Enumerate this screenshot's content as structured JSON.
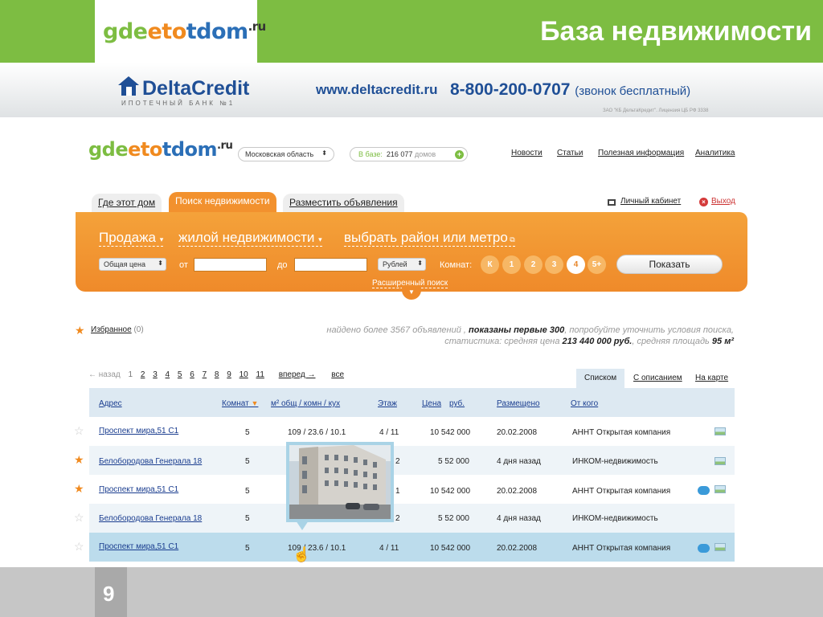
{
  "slide": {
    "logo": {
      "part1": "gde",
      "part2": "eto",
      "part3": "tdom",
      "suffix": ".ru"
    },
    "title": "База недвижимости",
    "page_number": "9"
  },
  "banner": {
    "brand": "DeltaCredit",
    "tagline": "ИПОТЕЧНЫЙ БАНК №1",
    "url": "www.deltacredit.ru",
    "phone": "8-800-200-0707",
    "phone_note": "(звонок бесплатный)",
    "legal": "ЗАО \"КБ ДельтаКредит\". Лицензия ЦБ РФ 3338"
  },
  "site": {
    "logo": {
      "part1": "gde",
      "part2": "eto",
      "part3": "tdom",
      "suffix": ".ru"
    },
    "region": "Московская область",
    "base_label": "В базе:",
    "base_count": "216 077",
    "base_unit": "домов",
    "nav": [
      "Новости",
      "Статьи",
      "Полезная информация",
      "Аналитика"
    ]
  },
  "tabs": [
    "Где этот дом",
    "Поиск недвижимости",
    "Разместить объявления"
  ],
  "account": {
    "cabinet": "Личный кабинет",
    "logout": "Выход"
  },
  "search": {
    "deal": "Продажа",
    "type": "жилой недвижимости",
    "area": "выбрать район или метро",
    "price_type": "Общая цена",
    "from_label": "от",
    "to_label": "до",
    "currency": "Рублей",
    "rooms_label": "Комнат:",
    "rooms": [
      "К",
      "1",
      "2",
      "3",
      "4",
      "5+"
    ],
    "rooms_selected": "4",
    "show_button": "Показать",
    "advanced": "Расширенный поиск"
  },
  "results": {
    "favorites_label": "Избранное",
    "favorites_count": "(0)",
    "found_prefix": "найдено более 3567 объявлений ,",
    "found_shown": "показаны первые 300",
    "found_suffix": ", попробуйте уточнить условия поиска,",
    "stats_prefix": "статистика: средняя цена",
    "stats_price": "213 440 000 руб.",
    "stats_mid": ", средняя площадь",
    "stats_area": "95 м²"
  },
  "pager": {
    "prev": "← назад",
    "current": "1",
    "pages": [
      "2",
      "3",
      "4",
      "5",
      "6",
      "7",
      "8",
      "9",
      "10",
      "11"
    ],
    "next": "вперед →",
    "all": "все"
  },
  "view_tabs": [
    "Списком",
    "С описанием",
    "На карте"
  ],
  "table": {
    "headers": [
      "Адрес",
      "Комнат",
      "м² общ / комн / кух",
      "Этаж",
      "Цена",
      "руб.",
      "Размещено",
      "От кого"
    ],
    "rows": [
      {
        "address": "Проспект мира,51 С1",
        "rooms": "5",
        "area": "109 / 23.6  / 10.1",
        "floor": "4 / 11",
        "price": "10 542 000",
        "date": "20.02.2008",
        "from": "АННТ Открытая компания",
        "fav": false
      },
      {
        "address": "Белобородова Генерала 18",
        "rooms": "5",
        "area": "",
        "floor": "2",
        "price": "5 52 000",
        "date": "4 дня назад",
        "from": "ИНКОМ-недвижимость",
        "fav": true
      },
      {
        "address": "Проспект мира,51 С1",
        "rooms": "5",
        "area": "",
        "floor": "1",
        "price": "10 542 000",
        "date": "20.02.2008",
        "from": "АННТ Открытая компания",
        "fav": true
      },
      {
        "address": "Белобородова Генерала 18",
        "rooms": "5",
        "area": "",
        "floor": "2",
        "price": "5 52 000",
        "date": "4 дня назад",
        "from": "ИНКОМ-недвижимость",
        "fav": false
      },
      {
        "address": "Проспект мира,51 С1",
        "rooms": "5",
        "area": "109 / 23.6  / 10.1",
        "floor": "4 / 11",
        "price": "10 542 000",
        "date": "20.02.2008",
        "from": "АННТ Открытая компания",
        "fav": false
      }
    ]
  },
  "colors": {
    "green": "#7dbd42",
    "orange": "#f08a1f",
    "link": "#1a3d8f",
    "selected_row": "#bcdcec"
  }
}
